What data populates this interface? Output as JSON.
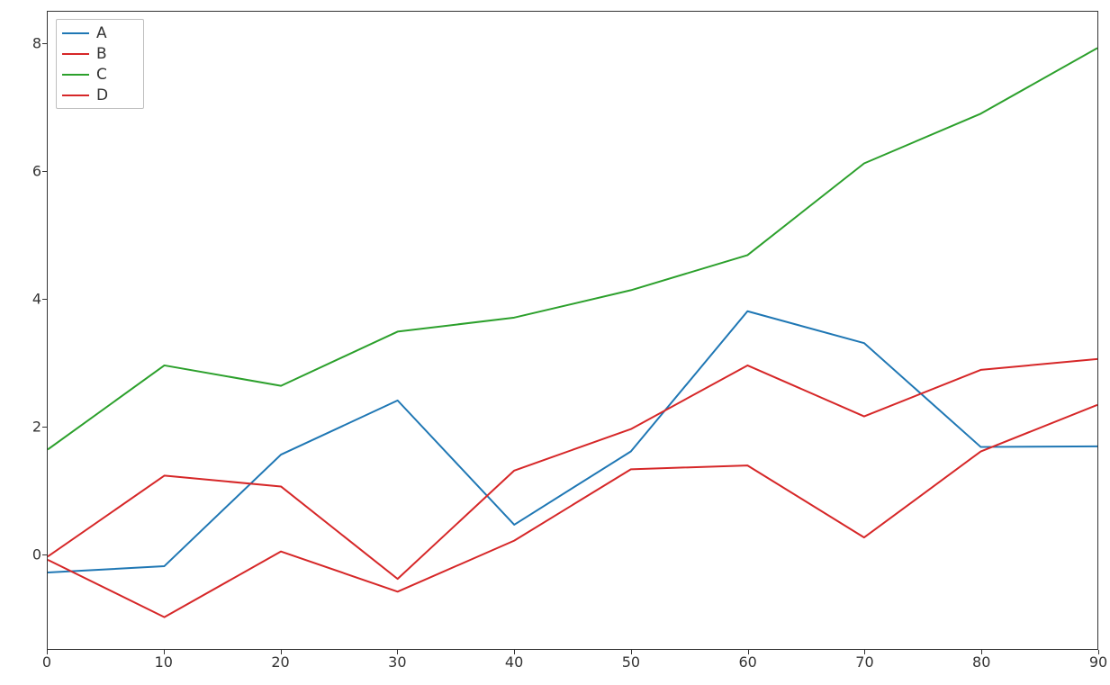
{
  "chart_data": {
    "type": "line",
    "x": [
      0,
      10,
      20,
      30,
      40,
      50,
      60,
      70,
      80,
      90
    ],
    "series": [
      {
        "name": "A",
        "color": "#1f77b4",
        "values": [
          -0.3,
          -0.2,
          1.55,
          2.4,
          0.45,
          1.6,
          3.8,
          3.3,
          1.67,
          1.68
        ]
      },
      {
        "name": "B",
        "color": "#d62728",
        "values": [
          -0.05,
          1.22,
          1.05,
          -0.4,
          1.3,
          1.95,
          2.95,
          2.15,
          2.88,
          3.05
        ]
      },
      {
        "name": "C",
        "color": "#2ca02c",
        "values": [
          1.63,
          2.95,
          2.63,
          3.48,
          3.7,
          4.13,
          4.68,
          6.12,
          6.9,
          7.93
        ]
      },
      {
        "name": "D",
        "color": "#d62728",
        "values": [
          -0.1,
          -1.0,
          0.03,
          -0.6,
          0.2,
          1.32,
          1.38,
          0.25,
          1.6,
          2.33
        ]
      }
    ],
    "xlabel": "",
    "ylabel": "",
    "title": "",
    "xlim": [
      0,
      90
    ],
    "ylim": [
      -1.5,
      8.5
    ],
    "xticks": [
      0,
      10,
      20,
      30,
      40,
      50,
      60,
      70,
      80,
      90
    ],
    "yticks": [
      0,
      2,
      4,
      6,
      8
    ],
    "xtick_labels": [
      "0",
      "10",
      "20",
      "30",
      "40",
      "50",
      "60",
      "70",
      "80",
      "90"
    ],
    "ytick_labels": [
      "0",
      "2",
      "4",
      "6",
      "8"
    ],
    "legend_pos": "upper-left"
  }
}
